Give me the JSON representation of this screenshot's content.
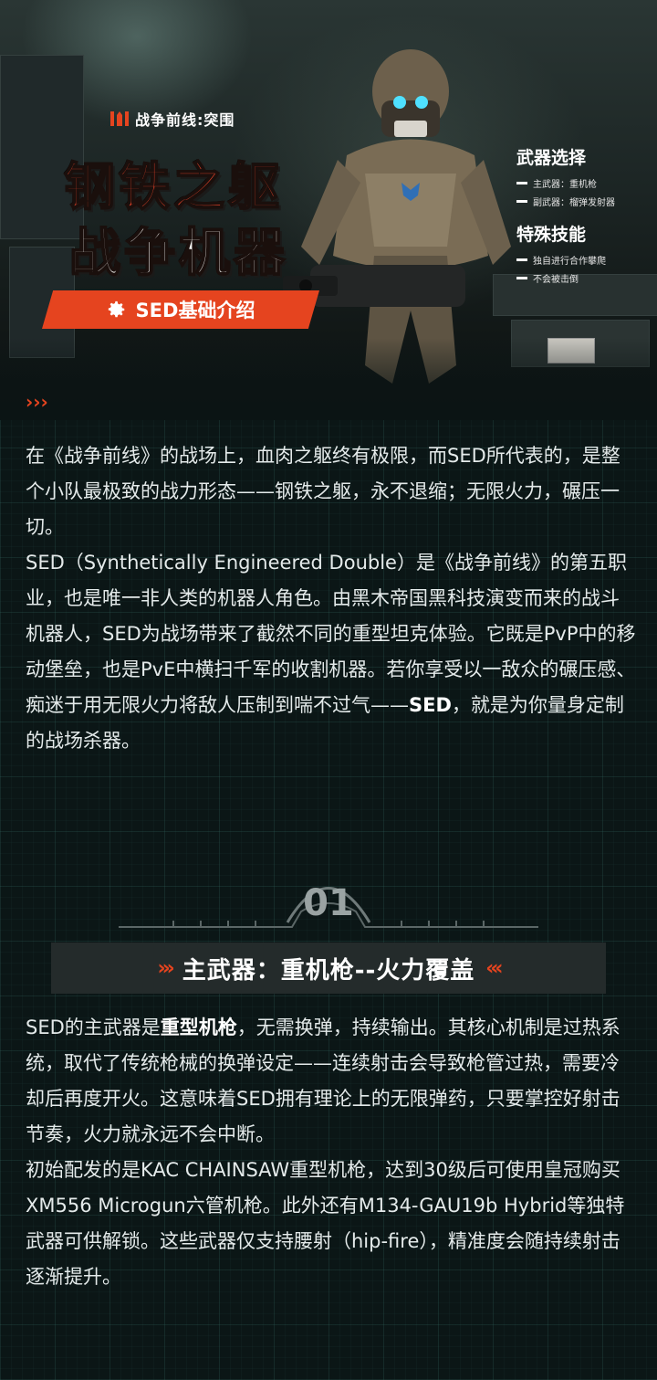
{
  "hero": {
    "logo_text": "战争前线:突围",
    "title_line1": "钢铁之躯",
    "title_line2": "战争机器",
    "banner_text": "SED基础介绍",
    "side_panel": {
      "weapons_heading": "武器选择",
      "weapon_items": [
        "主武器：重机枪",
        "副武器：榴弹发射器"
      ],
      "skills_heading": "特殊技能",
      "skill_items": [
        "独自进行合作攀爬",
        "不会被击倒"
      ]
    },
    "arrows": "›››"
  },
  "intro": {
    "p1": "在《战争前线》的战场上，血肉之躯终有极限，而SED所代表的，是整个小队最极致的战力形态——钢铁之躯，永不退缩；无限火力，碾压一切。",
    "p2_before": "SED（Synthetically Engineered Double）是《战争前线》的第五职业，也是唯一非人类的机器人角色。由黑木帝国黑科技演变而来的战斗机器人，SED为战场带来了截然不同的重型坦克体验。它既是PvP中的移动堡垒，也是PvE中横扫千军的收割机器。若你享受以一敌众的碾压感、痴迷于用无限火力将敌人压制到喘不过气——",
    "p2_strong": "SED",
    "p2_after": "，就是为你量身定制的战场杀器。"
  },
  "section1": {
    "number": "01",
    "left_chevrons": "›››",
    "title": "主武器：重机枪--火力覆盖",
    "right_chevrons": "‹‹‹",
    "p1_before": "SED的主武器是",
    "p1_strong": "重型机枪",
    "p1_after": "，无需换弹，持续输出。其核心机制是过热系统，取代了传统枪械的换弹设定——连续射击会导致枪管过热，需要冷却后再度开火。这意味着SED拥有理论上的无限弹药，只要掌控好射击节奏，火力就永远不会中断。",
    "p2": "初始配发的是KAC CHAINSAW重型机枪，达到30级后可使用皇冠购买XM556 Microgun六管机枪。此外还有M134-GAU19b Hybrid等独特武器可供解锁。这些武器仅支持腰射（hip-fire），精准度会随持续射击逐渐提升。"
  },
  "colors": {
    "accent": "#e5441f",
    "background": "#0b1414",
    "text": "#e4eaea"
  }
}
